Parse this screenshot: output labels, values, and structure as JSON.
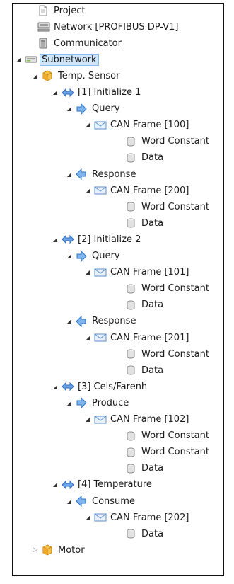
{
  "tree": {
    "items": [
      {
        "label": "Project",
        "icon": "document-icon",
        "expander": "none"
      },
      {
        "label": "Network [PROFIBUS DP-V1]",
        "icon": "network-icon",
        "expander": "none"
      },
      {
        "label": "Communicator",
        "icon": "device-icon",
        "expander": "none"
      },
      {
        "label": "Subnetwork",
        "icon": "subnetwork-icon",
        "expander": "open",
        "selected": true
      },
      {
        "label": "Temp. Sensor",
        "icon": "node-cube-icon",
        "expander": "open"
      },
      {
        "label": "[1] Initialize 1",
        "icon": "exchange-arrows-icon",
        "expander": "open"
      },
      {
        "label": "Query",
        "icon": "arrow-right-icon",
        "expander": "open"
      },
      {
        "label": "CAN Frame [100]",
        "icon": "envelope-icon",
        "expander": "open"
      },
      {
        "label": "Word Constant",
        "icon": "cylinder-icon",
        "expander": "none"
      },
      {
        "label": "Data",
        "icon": "cylinder-icon",
        "expander": "none"
      },
      {
        "label": "Response",
        "icon": "arrow-left-icon",
        "expander": "open"
      },
      {
        "label": "CAN Frame [200]",
        "icon": "envelope-icon",
        "expander": "open"
      },
      {
        "label": "Word Constant",
        "icon": "cylinder-icon",
        "expander": "none"
      },
      {
        "label": "Data",
        "icon": "cylinder-icon",
        "expander": "none"
      },
      {
        "label": "[2] Initialize 2",
        "icon": "exchange-arrows-icon",
        "expander": "open"
      },
      {
        "label": "Query",
        "icon": "arrow-right-icon",
        "expander": "open"
      },
      {
        "label": "CAN Frame [101]",
        "icon": "envelope-icon",
        "expander": "open"
      },
      {
        "label": "Word Constant",
        "icon": "cylinder-icon",
        "expander": "none"
      },
      {
        "label": "Data",
        "icon": "cylinder-icon",
        "expander": "none"
      },
      {
        "label": "Response",
        "icon": "arrow-left-icon",
        "expander": "open"
      },
      {
        "label": "CAN Frame [201]",
        "icon": "envelope-icon",
        "expander": "open"
      },
      {
        "label": "Word Constant",
        "icon": "cylinder-icon",
        "expander": "none"
      },
      {
        "label": "Data",
        "icon": "cylinder-icon",
        "expander": "none"
      },
      {
        "label": "[3] Cels/Farenh",
        "icon": "exchange-arrows-icon",
        "expander": "open"
      },
      {
        "label": "Produce",
        "icon": "arrow-right-icon",
        "expander": "open"
      },
      {
        "label": "CAN Frame [102]",
        "icon": "envelope-icon",
        "expander": "open"
      },
      {
        "label": "Word Constant",
        "icon": "cylinder-icon",
        "expander": "none"
      },
      {
        "label": "Word Constant",
        "icon": "cylinder-icon",
        "expander": "none"
      },
      {
        "label": "Data",
        "icon": "cylinder-icon",
        "expander": "none"
      },
      {
        "label": "[4] Temperature",
        "icon": "exchange-arrows-icon",
        "expander": "open"
      },
      {
        "label": "Consume",
        "icon": "arrow-left-icon",
        "expander": "open"
      },
      {
        "label": "CAN Frame [202]",
        "icon": "envelope-icon",
        "expander": "open"
      },
      {
        "label": "Data",
        "icon": "cylinder-icon",
        "expander": "none"
      },
      {
        "label": "Motor",
        "icon": "node-cube-icon",
        "expander": "closed"
      }
    ]
  }
}
